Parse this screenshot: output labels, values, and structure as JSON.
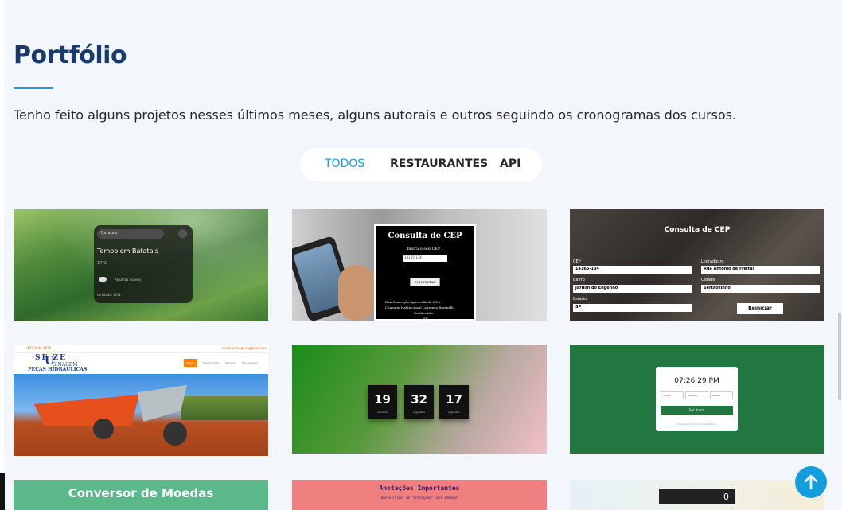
{
  "section": {
    "title": "Portfólio",
    "description": "Tenho feito alguns projetos nesses últimos meses, alguns autorais e outros seguindo os cronogramas dos cursos."
  },
  "filters": [
    {
      "label": "TODOS",
      "active": true
    },
    {
      "label": "RESTAURANTES",
      "active": false
    },
    {
      "label": "API",
      "active": false
    }
  ],
  "cards": {
    "weather": {
      "search": "Batatais",
      "title": "Tempo em Batatais",
      "temp": "17°C",
      "condition": "Algumas nuvens",
      "humidity": "Umidade: 60%"
    },
    "cep1": {
      "title": "Consulta de CEP",
      "prompt": "Insira o seu CEP :",
      "input": "14165-134",
      "button": "CONSULTAR",
      "results": [
        "Rua Conceição Aparecida da Silva",
        "Conjunto Habitacional Lourenço Boranello",
        "Sertãozinho",
        "SP"
      ]
    },
    "cep2": {
      "title": "Consulta de CEP",
      "labels": {
        "cep": "CEP",
        "bairro": "Bairro",
        "estado": "Estado",
        "logradouro": "Logradouro",
        "cidade": "Cidade"
      },
      "values": {
        "cep": "14165-134",
        "bairro": "Jardim do Engenho",
        "estado": "SP",
        "logradouro": "Rua Antonio de Freitas",
        "cidade": "Sertãozinho"
      },
      "button": "Reiniciar"
    },
    "usinagem": {
      "phone": "(16) 3942-4530",
      "email": "seuze.usinagem@gmail.com",
      "brand_top": "SE ZE",
      "brand_letter": "U",
      "brand_bottom": "SINAGEM",
      "brand_sub": "PEÇAS HIDRÁULICAS",
      "nav": [
        "Home",
        "Quem Somos",
        "Serviços",
        "Fale Conosco"
      ]
    },
    "countdown": {
      "values": [
        "19",
        "32",
        "17"
      ],
      "labels": [
        "minutos",
        "segundos",
        "segundos"
      ]
    },
    "alarm": {
      "time": "07:26:29 PM",
      "selects": [
        "Horas",
        "Minutos",
        "AM/PM"
      ],
      "button": "Set Alarm",
      "footer": "Copyright © Alarm Clock Online"
    },
    "moedas": {
      "title": "Conversor de Moedas"
    },
    "anotacoes": {
      "title": "Anotações Importantes",
      "sub": "Basta clicar em \"Anotações\" para começar"
    },
    "counter": {
      "value": "0"
    }
  },
  "colors": {
    "accent": "#149ddd",
    "title": "#173b6c",
    "background": "#f3f6fb"
  },
  "icons": {
    "scroll_top": "arrow-up-icon"
  }
}
